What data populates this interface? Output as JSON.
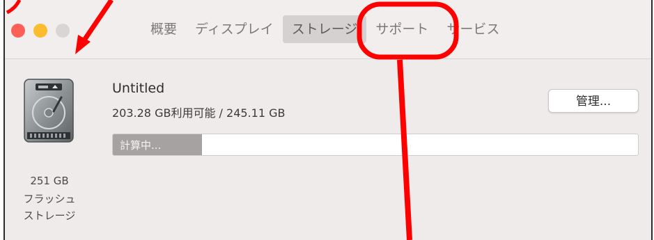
{
  "window": {
    "tabs": [
      {
        "label": "概要",
        "selected": false
      },
      {
        "label": "ディスプレイ",
        "selected": false
      },
      {
        "label": "ストレージ",
        "selected": true
      },
      {
        "label": "サポート",
        "selected": false
      },
      {
        "label": "サービス",
        "selected": false
      }
    ]
  },
  "storage": {
    "disk_capacity": "251 GB",
    "disk_type_line1": "フラッシュ",
    "disk_type_line2": "ストレージ",
    "volume_name": "Untitled",
    "usage_text": "203.28 GB利用可能 / 245.11 GB",
    "manage_button_label": "管理...",
    "bar_label": "計算中...",
    "bar_fill_fraction": 0.17
  },
  "colors": {
    "close": "#fc5f57",
    "minimize": "#fdbc2e",
    "zoom_inactive": "#d8d5d4",
    "annotation": "#ff0000"
  }
}
